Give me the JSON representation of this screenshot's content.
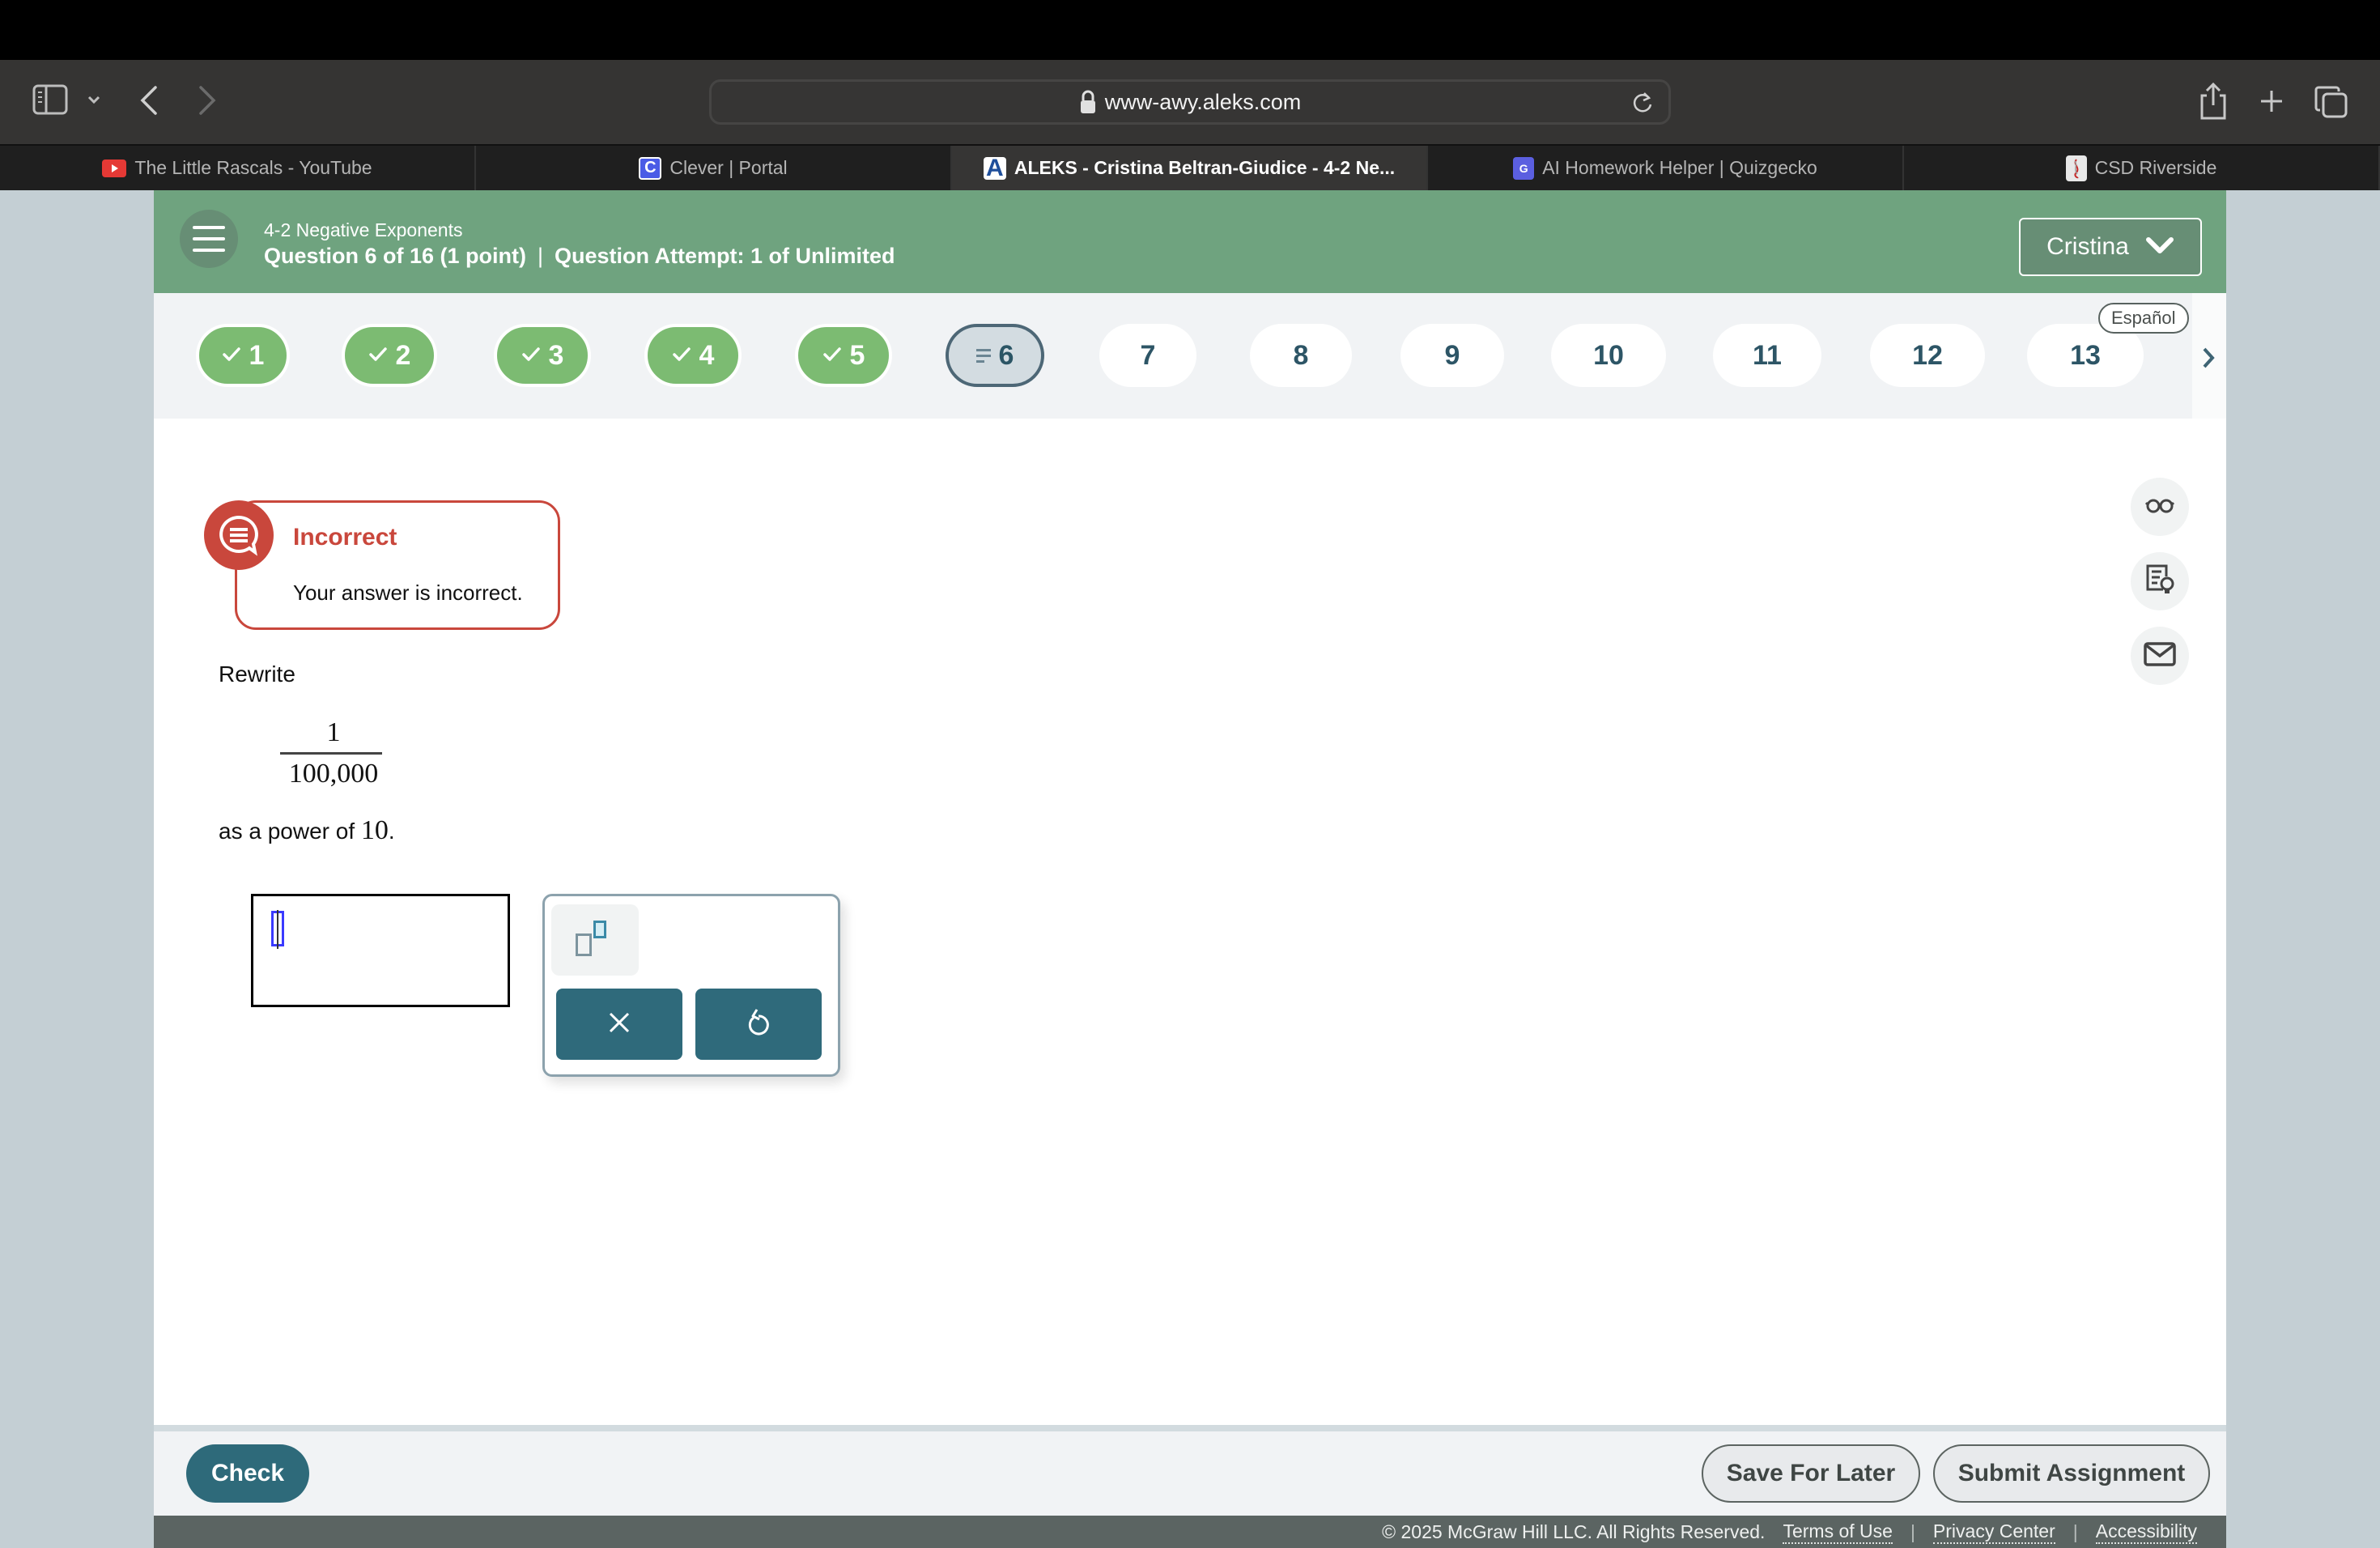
{
  "browser": {
    "url": "www-awy.aleks.com",
    "tabs": [
      {
        "label": "The Little Rascals - YouTube",
        "favicon": "youtube-icon",
        "favicon_color": "#e53935",
        "active": false
      },
      {
        "label": "Clever | Portal",
        "favicon": "clever-icon",
        "favicon_char": "C",
        "favicon_color": "#4a5be6",
        "active": false
      },
      {
        "label": "ALEKS - Cristina Beltran-Giudice - 4-2 Ne...",
        "favicon": "aleks-icon",
        "favicon_char": "A",
        "favicon_color": "#1f4f9b",
        "active": true
      },
      {
        "label": "AI Homework Helper | Quizgecko",
        "favicon": "quizgecko-icon",
        "favicon_color": "#5b5fe0",
        "active": false
      },
      {
        "label": "CSD Riverside",
        "favicon": "csd-riverside-icon",
        "favicon_color": "#e8e8e8",
        "active": false
      }
    ]
  },
  "header": {
    "topic": "4-2 Negative Exponents",
    "question_info": "Question 6 of 16 (1 point)",
    "separator": "|",
    "attempt_info": "Question Attempt: 1 of Unlimited",
    "user_name": "Cristina",
    "color": "#6fa37f"
  },
  "question_nav": {
    "language_toggle": "Español",
    "items": [
      {
        "number": "1",
        "status": "done"
      },
      {
        "number": "2",
        "status": "done"
      },
      {
        "number": "3",
        "status": "done"
      },
      {
        "number": "4",
        "status": "done"
      },
      {
        "number": "5",
        "status": "done"
      },
      {
        "number": "6",
        "status": "current"
      },
      {
        "number": "7",
        "status": "todo"
      },
      {
        "number": "8",
        "status": "todo"
      },
      {
        "number": "9",
        "status": "todo"
      },
      {
        "number": "10",
        "status": "todo"
      },
      {
        "number": "11",
        "status": "todo"
      },
      {
        "number": "12",
        "status": "todo"
      },
      {
        "number": "13",
        "status": "todo"
      }
    ],
    "done_color": "#7cbb72"
  },
  "feedback": {
    "title": "Incorrect",
    "message": "Your answer is incorrect.",
    "color": "#c9473c"
  },
  "question": {
    "prefix": "Rewrite",
    "numerator": "1",
    "denominator": "100,000",
    "suffix_text": "as a power of ",
    "suffix_math": "10",
    "suffix_end": "."
  },
  "answer": {
    "value": ""
  },
  "palette": {
    "exponent_button": "exponent-template",
    "clear_button": "clear",
    "undo_button": "undo"
  },
  "tools": [
    "glasses-icon",
    "worked-example-icon",
    "mail-icon"
  ],
  "actions": {
    "check": "Check",
    "save_for_later": "Save For Later",
    "submit": "Submit Assignment"
  },
  "footer": {
    "copyright": "© 2025 McGraw Hill LLC. All Rights Reserved.",
    "links": [
      "Terms of Use",
      "Privacy Center",
      "Accessibility"
    ]
  }
}
